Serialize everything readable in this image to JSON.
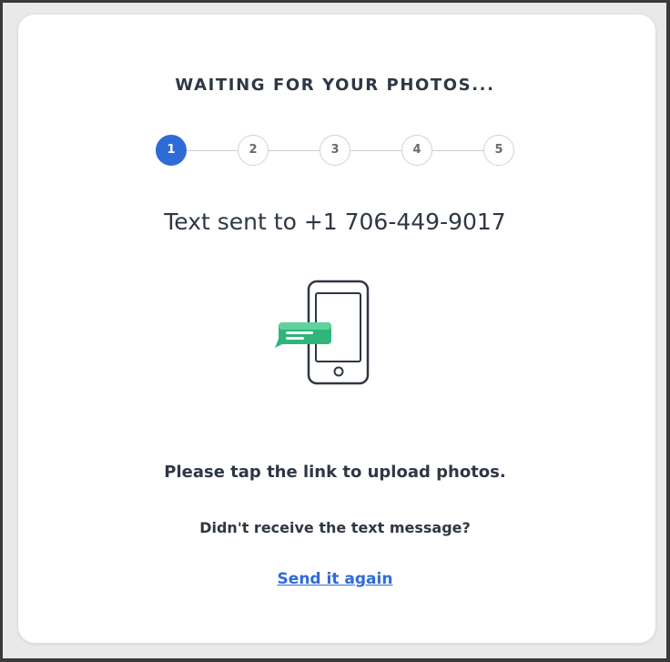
{
  "title": "WAITING FOR YOUR PHOTOS...",
  "stepper": {
    "steps": [
      "1",
      "2",
      "3",
      "4",
      "5"
    ],
    "active_step": 1,
    "active_color": "#2f6bd6"
  },
  "sent_message": "Text sent to +1 706-449-9017",
  "illustration": {
    "icon": "phone-with-message-icon",
    "bubble_color": "#2fb57a"
  },
  "instruction": "Please tap the link to upload photos.",
  "question": "Didn't receive the text message?",
  "resend_link": "Send it again"
}
